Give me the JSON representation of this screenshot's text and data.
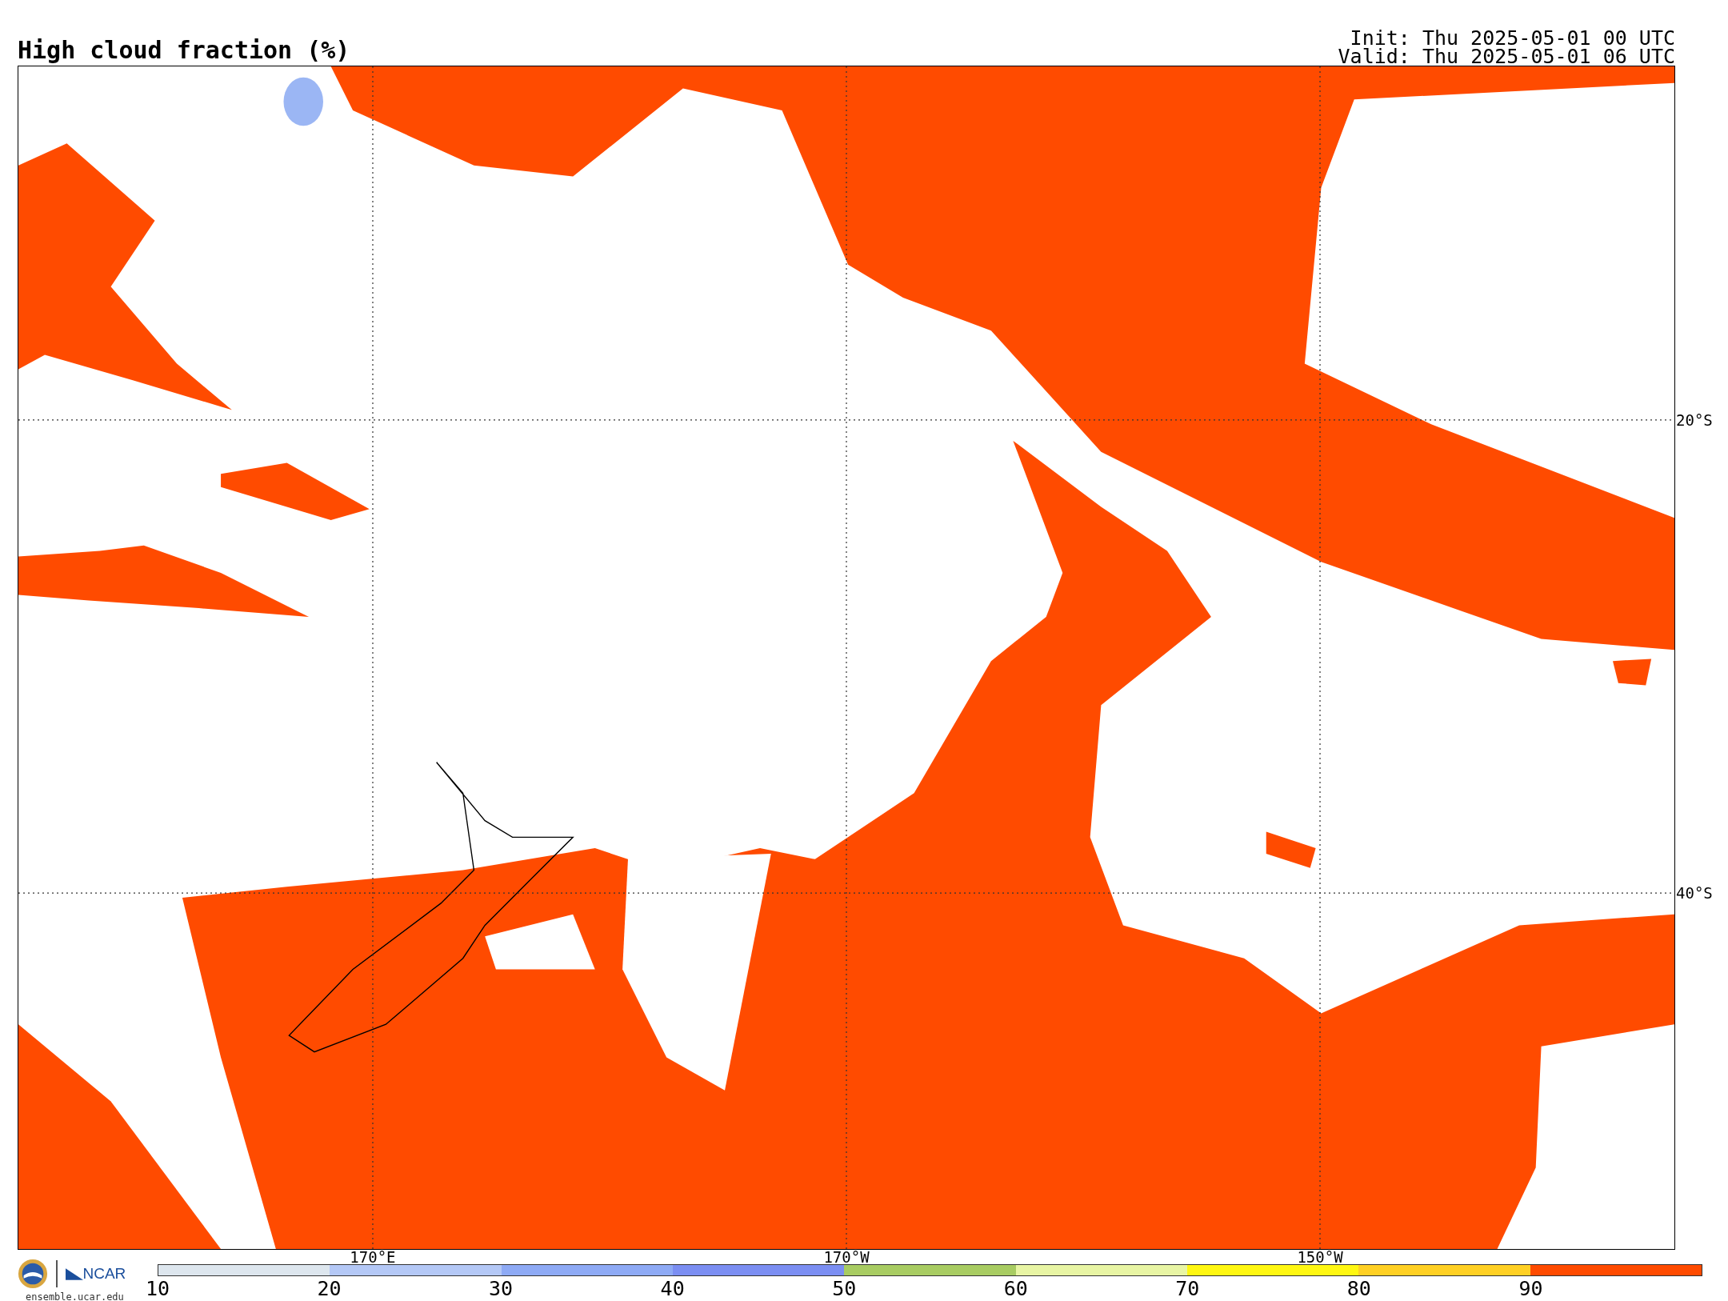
{
  "title": "High cloud fraction (%)",
  "init": "Init: Thu 2025-05-01 00 UTC",
  "valid": "Valid: Thu 2025-05-01 06 UTC",
  "map": {
    "longitude_labels": [
      "170°E",
      "170°W",
      "150°W"
    ],
    "latitude_labels": [
      "20°S",
      "40°S"
    ]
  },
  "logo": {
    "name": "NCAR",
    "url": "ensemble.ucar.edu"
  },
  "colorbar": {
    "segments": [
      {
        "color": "#dde6ee"
      },
      {
        "color": "#b4c8f6"
      },
      {
        "color": "#8eaaf5"
      },
      {
        "color": "#7b8ef2"
      },
      {
        "color": "#a8cc62"
      },
      {
        "color": "#e8f5a4"
      },
      {
        "color": "#fff712"
      },
      {
        "color": "#ffd024"
      },
      {
        "color": "#ff4b00"
      }
    ],
    "ticks": [
      "10",
      "20",
      "30",
      "40",
      "50",
      "60",
      "70",
      "80",
      "90"
    ]
  }
}
